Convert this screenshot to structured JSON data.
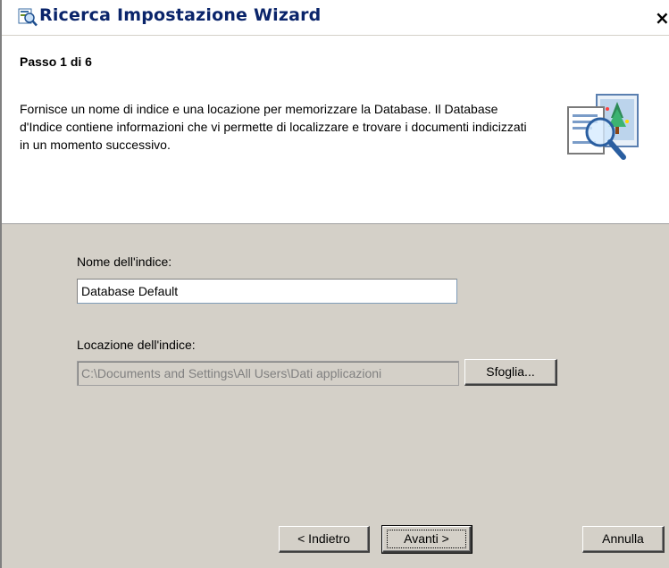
{
  "window": {
    "title": "Ricerca Impostazione Wizard",
    "close_label": "×",
    "icon": "search-wizard-icon"
  },
  "header": {
    "step": "Passo 1 di 6",
    "description": "Fornisce un nome di indice e una locazione per memorizzare la Database. Il Database d'Indice contiene informazioni che vi permette di localizzare e trovare i documenti indicizzati in un momento successivo.",
    "illustration": "document-magnifier-icon"
  },
  "form": {
    "index_name_label": "Nome dell'indice:",
    "index_name_value": "Database Default",
    "index_location_label": "Locazione dell'indice:",
    "index_location_value": "C:\\Documents and Settings\\All Users\\Dati applicazioni",
    "browse_label": "Sfoglia..."
  },
  "footer": {
    "back_label": "< Indietro",
    "next_label": "Avanti >",
    "cancel_label": "Annulla"
  },
  "colors": {
    "title_text": "#0a246a",
    "dialog_bg": "#d4d0c8",
    "header_bg": "#ffffff"
  }
}
